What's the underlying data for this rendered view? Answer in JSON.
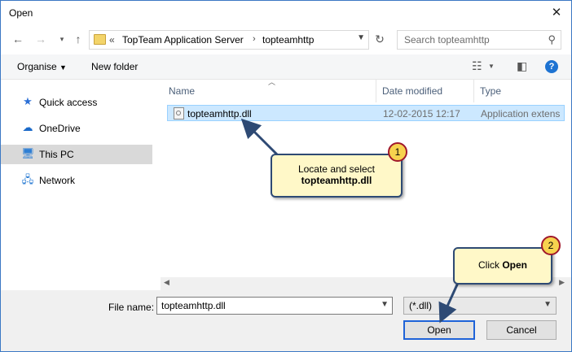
{
  "window": {
    "title": "Open"
  },
  "nav": {
    "back_icon": "arrow-left-icon",
    "forward_icon": "arrow-right-icon",
    "up_icon": "arrow-up-icon",
    "address_prefix": "«",
    "breadcrumb": [
      "TopTeam Application Server",
      "topteamhttp"
    ],
    "search_placeholder": "Search topteamhttp"
  },
  "toolbar": {
    "organise_label": "Organise",
    "new_folder_label": "New folder"
  },
  "sidebar": {
    "items": [
      {
        "label": "Quick access",
        "icon": "star-icon"
      },
      {
        "label": "OneDrive",
        "icon": "cloud-icon"
      },
      {
        "label": "This PC",
        "icon": "computer-icon"
      },
      {
        "label": "Network",
        "icon": "network-icon"
      }
    ],
    "selected": "This PC"
  },
  "columns": {
    "name": "Name",
    "date": "Date modified",
    "type": "Type"
  },
  "files": [
    {
      "name": "topteamhttp.dll",
      "date": "12-02-2015 12:17",
      "type": "Application extens"
    }
  ],
  "bottom": {
    "file_name_label": "File name:",
    "file_name_value": "topteamhttp.dll",
    "file_type_value": "(*.dll)",
    "open_label": "Open",
    "cancel_label": "Cancel"
  },
  "callouts": [
    {
      "number": "1",
      "line1": "Locate and select",
      "line2": "topteamhttp.dll"
    },
    {
      "number": "2",
      "prefix": "Click ",
      "bold": "Open"
    }
  ],
  "colors": {
    "selection": "#cce8ff",
    "accent": "#1f63d8",
    "callout_bg": "#fff8c8",
    "badge": "#f7d24e"
  }
}
